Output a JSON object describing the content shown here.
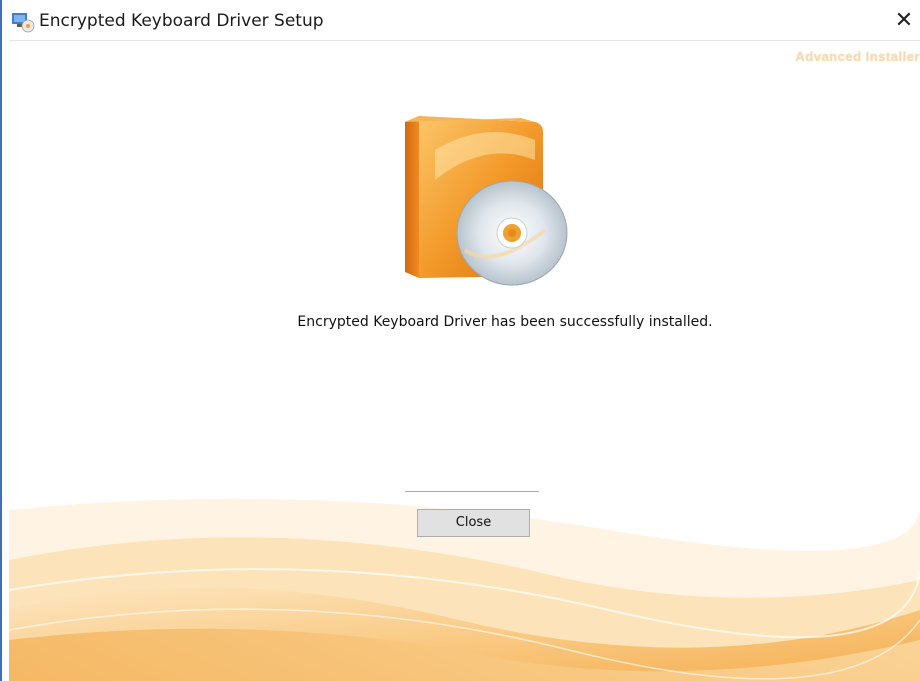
{
  "window": {
    "title": "Encrypted Keyboard Driver Setup",
    "close_glyph": "✕"
  },
  "branding": {
    "text": "Advanced Installer"
  },
  "main": {
    "message": "Encrypted Keyboard Driver has been successfully installed."
  },
  "footer": {
    "close_label": "Close"
  },
  "icons": {
    "app": "installer-app-icon",
    "hero": "software-box-cd-icon"
  },
  "colors": {
    "window_border": "#3f6fb5",
    "accent_orange": "#f0a030",
    "button_bg": "#e1e1e1"
  }
}
